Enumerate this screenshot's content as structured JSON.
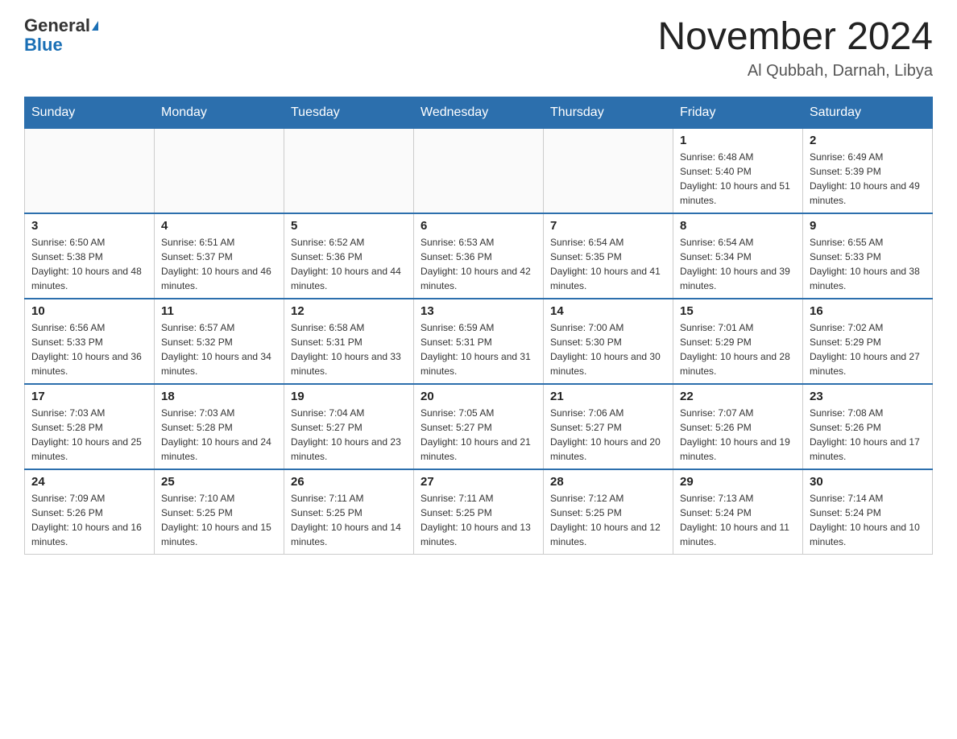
{
  "header": {
    "logo_general": "General",
    "logo_blue": "Blue",
    "month_title": "November 2024",
    "location": "Al Qubbah, Darnah, Libya"
  },
  "days_of_week": [
    "Sunday",
    "Monday",
    "Tuesday",
    "Wednesday",
    "Thursday",
    "Friday",
    "Saturday"
  ],
  "weeks": [
    [
      {
        "num": "",
        "info": ""
      },
      {
        "num": "",
        "info": ""
      },
      {
        "num": "",
        "info": ""
      },
      {
        "num": "",
        "info": ""
      },
      {
        "num": "",
        "info": ""
      },
      {
        "num": "1",
        "info": "Sunrise: 6:48 AM\nSunset: 5:40 PM\nDaylight: 10 hours and 51 minutes."
      },
      {
        "num": "2",
        "info": "Sunrise: 6:49 AM\nSunset: 5:39 PM\nDaylight: 10 hours and 49 minutes."
      }
    ],
    [
      {
        "num": "3",
        "info": "Sunrise: 6:50 AM\nSunset: 5:38 PM\nDaylight: 10 hours and 48 minutes."
      },
      {
        "num": "4",
        "info": "Sunrise: 6:51 AM\nSunset: 5:37 PM\nDaylight: 10 hours and 46 minutes."
      },
      {
        "num": "5",
        "info": "Sunrise: 6:52 AM\nSunset: 5:36 PM\nDaylight: 10 hours and 44 minutes."
      },
      {
        "num": "6",
        "info": "Sunrise: 6:53 AM\nSunset: 5:36 PM\nDaylight: 10 hours and 42 minutes."
      },
      {
        "num": "7",
        "info": "Sunrise: 6:54 AM\nSunset: 5:35 PM\nDaylight: 10 hours and 41 minutes."
      },
      {
        "num": "8",
        "info": "Sunrise: 6:54 AM\nSunset: 5:34 PM\nDaylight: 10 hours and 39 minutes."
      },
      {
        "num": "9",
        "info": "Sunrise: 6:55 AM\nSunset: 5:33 PM\nDaylight: 10 hours and 38 minutes."
      }
    ],
    [
      {
        "num": "10",
        "info": "Sunrise: 6:56 AM\nSunset: 5:33 PM\nDaylight: 10 hours and 36 minutes."
      },
      {
        "num": "11",
        "info": "Sunrise: 6:57 AM\nSunset: 5:32 PM\nDaylight: 10 hours and 34 minutes."
      },
      {
        "num": "12",
        "info": "Sunrise: 6:58 AM\nSunset: 5:31 PM\nDaylight: 10 hours and 33 minutes."
      },
      {
        "num": "13",
        "info": "Sunrise: 6:59 AM\nSunset: 5:31 PM\nDaylight: 10 hours and 31 minutes."
      },
      {
        "num": "14",
        "info": "Sunrise: 7:00 AM\nSunset: 5:30 PM\nDaylight: 10 hours and 30 minutes."
      },
      {
        "num": "15",
        "info": "Sunrise: 7:01 AM\nSunset: 5:29 PM\nDaylight: 10 hours and 28 minutes."
      },
      {
        "num": "16",
        "info": "Sunrise: 7:02 AM\nSunset: 5:29 PM\nDaylight: 10 hours and 27 minutes."
      }
    ],
    [
      {
        "num": "17",
        "info": "Sunrise: 7:03 AM\nSunset: 5:28 PM\nDaylight: 10 hours and 25 minutes."
      },
      {
        "num": "18",
        "info": "Sunrise: 7:03 AM\nSunset: 5:28 PM\nDaylight: 10 hours and 24 minutes."
      },
      {
        "num": "19",
        "info": "Sunrise: 7:04 AM\nSunset: 5:27 PM\nDaylight: 10 hours and 23 minutes."
      },
      {
        "num": "20",
        "info": "Sunrise: 7:05 AM\nSunset: 5:27 PM\nDaylight: 10 hours and 21 minutes."
      },
      {
        "num": "21",
        "info": "Sunrise: 7:06 AM\nSunset: 5:27 PM\nDaylight: 10 hours and 20 minutes."
      },
      {
        "num": "22",
        "info": "Sunrise: 7:07 AM\nSunset: 5:26 PM\nDaylight: 10 hours and 19 minutes."
      },
      {
        "num": "23",
        "info": "Sunrise: 7:08 AM\nSunset: 5:26 PM\nDaylight: 10 hours and 17 minutes."
      }
    ],
    [
      {
        "num": "24",
        "info": "Sunrise: 7:09 AM\nSunset: 5:26 PM\nDaylight: 10 hours and 16 minutes."
      },
      {
        "num": "25",
        "info": "Sunrise: 7:10 AM\nSunset: 5:25 PM\nDaylight: 10 hours and 15 minutes."
      },
      {
        "num": "26",
        "info": "Sunrise: 7:11 AM\nSunset: 5:25 PM\nDaylight: 10 hours and 14 minutes."
      },
      {
        "num": "27",
        "info": "Sunrise: 7:11 AM\nSunset: 5:25 PM\nDaylight: 10 hours and 13 minutes."
      },
      {
        "num": "28",
        "info": "Sunrise: 7:12 AM\nSunset: 5:25 PM\nDaylight: 10 hours and 12 minutes."
      },
      {
        "num": "29",
        "info": "Sunrise: 7:13 AM\nSunset: 5:24 PM\nDaylight: 10 hours and 11 minutes."
      },
      {
        "num": "30",
        "info": "Sunrise: 7:14 AM\nSunset: 5:24 PM\nDaylight: 10 hours and 10 minutes."
      }
    ]
  ]
}
